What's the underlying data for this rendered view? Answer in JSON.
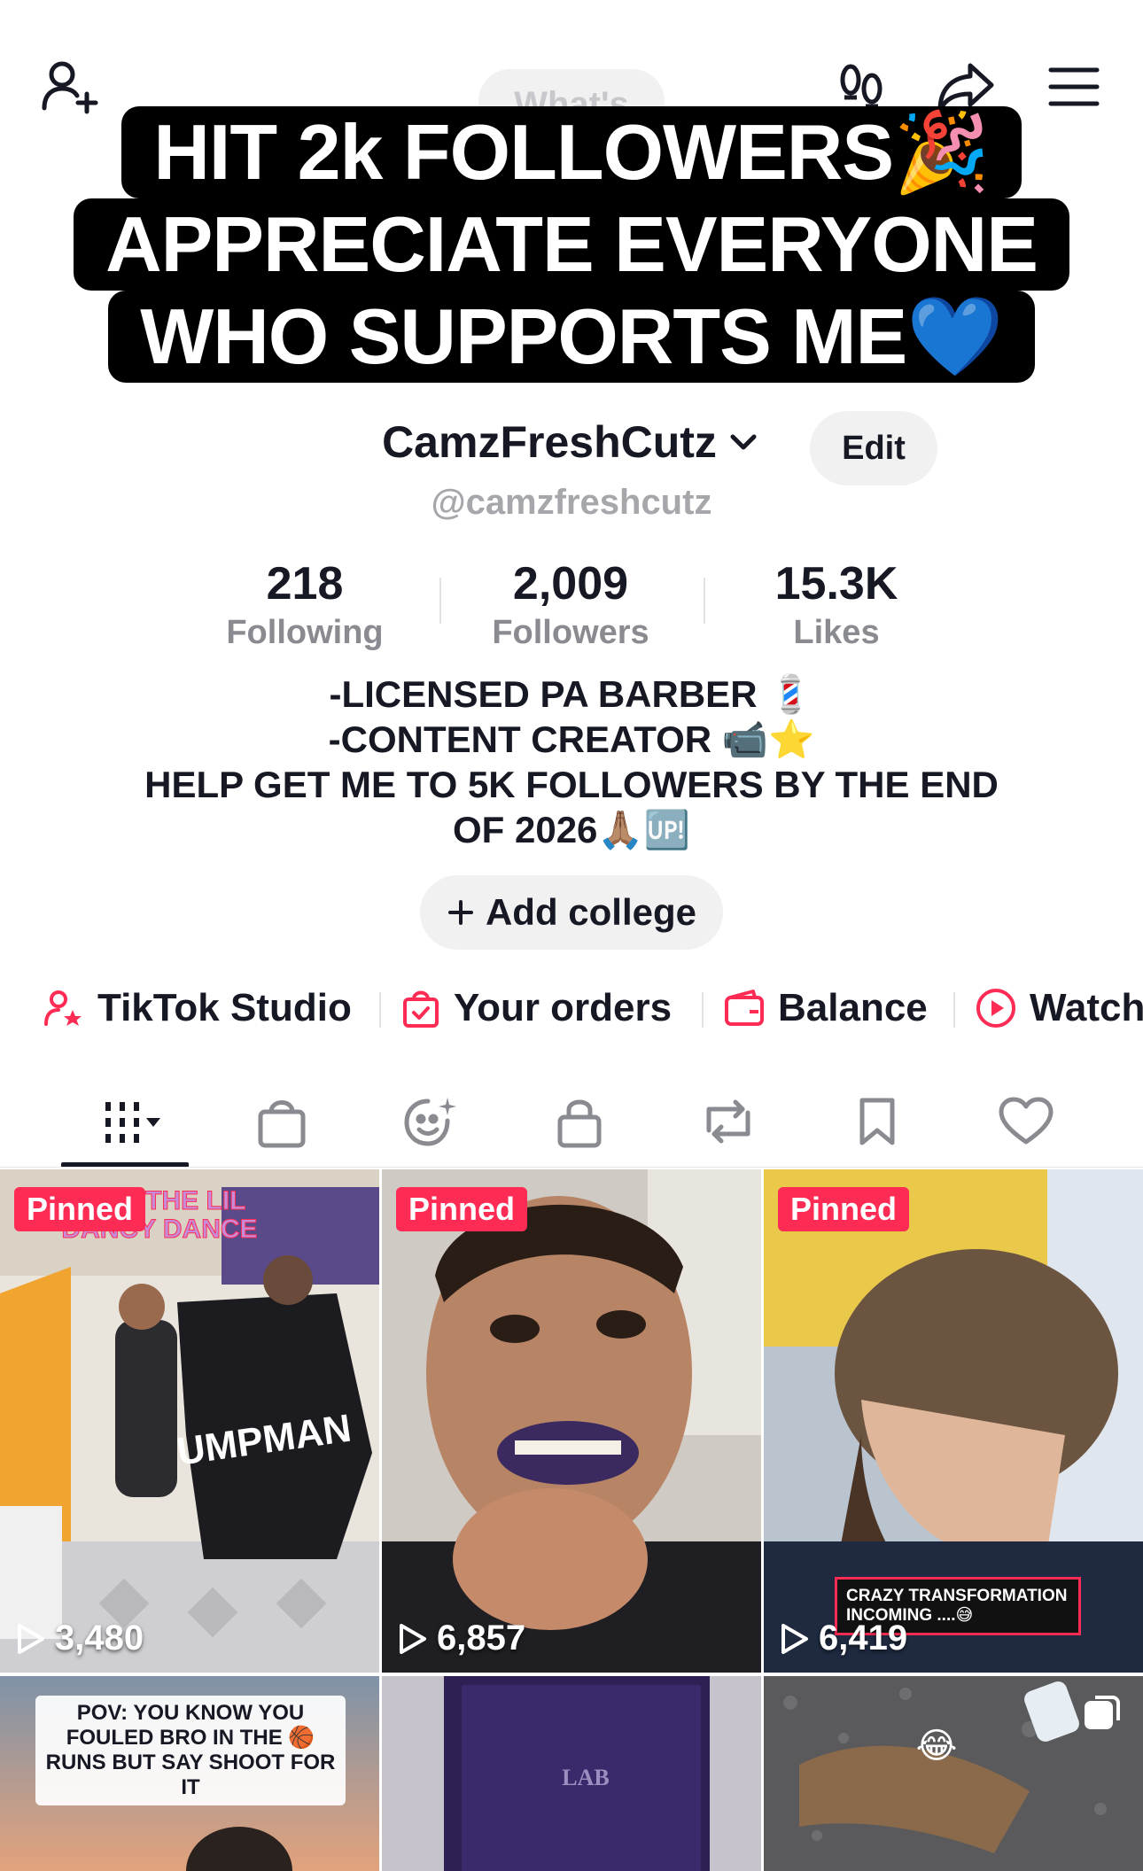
{
  "header": {
    "whats_label": "What's"
  },
  "caption": {
    "line1": "HIT 2k FOLLOWERS🎉",
    "line2": "APPRECIATE EVERYONE",
    "line3": "WHO SUPPORTS ME💙"
  },
  "profile": {
    "username": "CamzFreshCutz",
    "handle": "@camzfreshcutz",
    "edit_label": "Edit"
  },
  "stats": [
    {
      "value": "218",
      "label": "Following"
    },
    {
      "value": "2,009",
      "label": "Followers"
    },
    {
      "value": "15.3K",
      "label": "Likes"
    }
  ],
  "bio": {
    "line1": "-LICENSED PA BARBER 💈",
    "line2": "-CONTENT CREATOR 📹⭐",
    "line3": "HELP GET ME TO 5K FOLLOWERS BY THE END",
    "line4": "OF 2026🙏🏽🆙"
  },
  "add_college_label": "Add college",
  "shortcuts": [
    {
      "label": "TikTok Studio",
      "icon": "person-star-icon"
    },
    {
      "label": "Your orders",
      "icon": "shopping-bag-icon"
    },
    {
      "label": "Balance",
      "icon": "wallet-icon"
    },
    {
      "label": "Watch",
      "icon": "play-circle-icon"
    }
  ],
  "tabs": [
    {
      "name": "videos-grid",
      "icon": "grid-icon"
    },
    {
      "name": "shop",
      "icon": "bag-icon"
    },
    {
      "name": "ai-self",
      "icon": "sparkle-face-icon"
    },
    {
      "name": "private",
      "icon": "lock-icon"
    },
    {
      "name": "reposts",
      "icon": "repost-icon"
    },
    {
      "name": "favorites",
      "icon": "bookmark-icon"
    },
    {
      "name": "liked",
      "icon": "heart-icon"
    }
  ],
  "videos": [
    {
      "pinned": "Pinned",
      "views": "3,480",
      "overlay": "2 HIT THE LIL DANCY DANCE"
    },
    {
      "pinned": "Pinned",
      "views": "6,857"
    },
    {
      "pinned": "Pinned",
      "views": "6,419",
      "overlay": "CRAZY TRANSFORMATION INCOMING ....😅"
    },
    {
      "overlay": "POV: YOU KNOW YOU FOULED BRO IN THE 🏀 RUNS BUT SAY SHOOT FOR IT"
    },
    {
      "overlay": "LAB"
    },
    {
      "overlay": "😂"
    }
  ],
  "colors": {
    "accent": "#fe2c55",
    "text": "#161823",
    "muted": "#8a8b91",
    "pill_bg": "#f1f1f2"
  }
}
